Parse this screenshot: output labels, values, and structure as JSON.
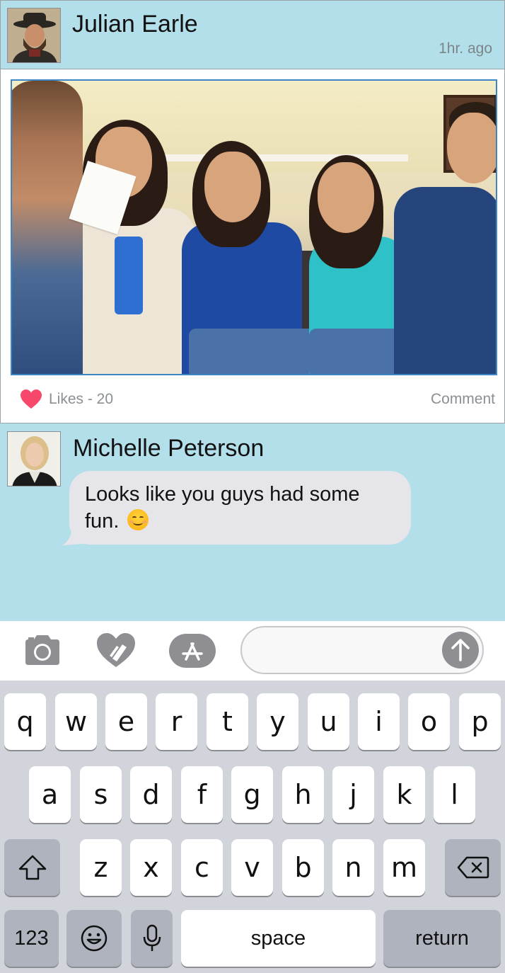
{
  "post": {
    "author": "Julian Earle",
    "timestamp": "1hr. ago",
    "likes_label": "Likes - 20",
    "comment_label": "Comment"
  },
  "comment": {
    "author": "Michelle Peterson",
    "text": "Looks like you guys had some fun."
  },
  "input": {
    "placeholder": ""
  },
  "keyboard": {
    "row1": [
      "q",
      "w",
      "e",
      "r",
      "t",
      "y",
      "u",
      "i",
      "o",
      "p"
    ],
    "row2": [
      "a",
      "s",
      "d",
      "f",
      "g",
      "h",
      "j",
      "k",
      "l"
    ],
    "row3": [
      "z",
      "x",
      "c",
      "v",
      "b",
      "n",
      "m"
    ],
    "numbers_label": "123",
    "space_label": "space",
    "return_label": "return"
  },
  "colors": {
    "background": "#b3dfea",
    "heart": "#f7476b",
    "photo_border": "#3c86c5",
    "keyboard": "#d1d4da"
  },
  "icons": [
    "camera-icon",
    "digital-touch-heart-icon",
    "app-store-icon",
    "send-arrow-icon",
    "heart-icon",
    "shift-icon",
    "backspace-icon",
    "emoji-icon",
    "microphone-icon",
    "smile-emoji"
  ]
}
